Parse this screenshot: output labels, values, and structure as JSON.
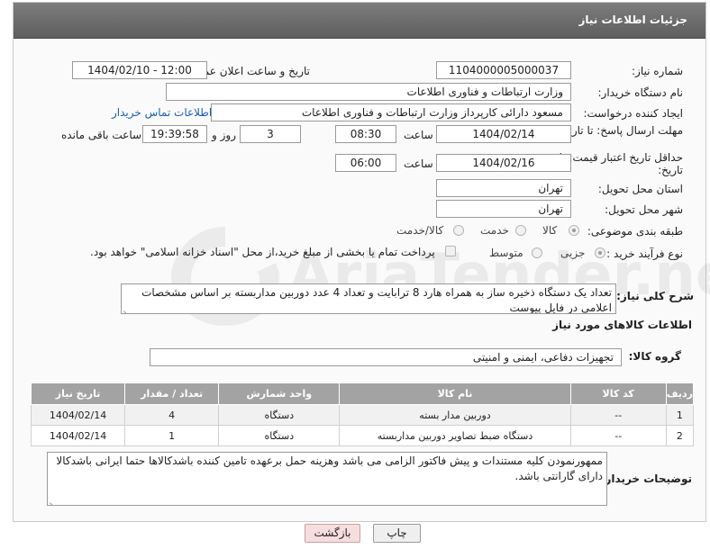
{
  "header": {
    "title": "جزئیات اطلاعات نیاز"
  },
  "form": {
    "need_number_label": "شماره نیاز:",
    "need_number": "1104000005000037",
    "announce_label": "تاریخ و ساعت اعلان عمومی:",
    "announce_value": "1404/02/10 - 12:00",
    "buyer_org_label": "نام دستگاه خریدار:",
    "buyer_org": "وزارت ارتباطات و فناوری اطلاعات",
    "creator_label": "ایجاد کننده درخواست:",
    "creator": "مسعود دارائی کارپرداز وزارت ارتباطات و فناوری اطلاعات",
    "contact_link": "اطلاعات تماس خریدار",
    "deadline_label": "مهلت ارسال پاسخ: تا تاریخ:",
    "deadline_date": "1404/02/14",
    "time_label": "ساعت",
    "deadline_time": "08:30",
    "days_value": "3",
    "days_and_label": "روز و",
    "remaining_time": "19:39:58",
    "remaining_label": "ساعت باقی مانده",
    "validity_label": "حداقل تاریخ اعتبار قیمت: تا تاریخ:",
    "validity_date": "1404/02/16",
    "validity_time": "06:00",
    "province_label": "استان محل تحویل:",
    "province": "تهران",
    "city_label": "شهر محل تحویل:",
    "city": "تهران",
    "category_label": "طبقه بندی موضوعی:",
    "category_options": [
      "کالا",
      "خدمت",
      "کالا/خدمت"
    ],
    "process_label": "نوع فرآیند خرید :",
    "process_options": [
      "جزیی",
      "متوسط"
    ],
    "payment_note": "پرداخت تمام یا بخشی از مبلغ خرید،از محل \"اسناد خزانه اسلامی\" خواهد بود."
  },
  "description": {
    "label": "شرح کلی نیاز:",
    "text": "تعداد یک دستگاه ذخیره ساز به همراه هارد 8 ترابایت و تعداد 4 عدد دوربین مداربسته بر اساس مشخصات اعلامی در فایل پیوست"
  },
  "goods": {
    "section_title": "اطلاعات کالاهای مورد نیاز",
    "group_label": "گروه کالا:",
    "group_value": "تجهیزات دفاعی، ایمنی و امنیتی",
    "columns": [
      "ردیف",
      "کد کالا",
      "نام کالا",
      "واحد شمارش",
      "تعداد / مقدار",
      "تاریخ نیاز"
    ],
    "rows": [
      [
        "1",
        "--",
        "دوربین مدار بسته",
        "دستگاه",
        "4",
        "1404/02/14"
      ],
      [
        "2",
        "--",
        "دستگاه ضبط تصاویر دوربین مداربسته",
        "دستگاه",
        "1",
        "1404/02/14"
      ]
    ]
  },
  "buyer_notes": {
    "label": "توضیحات خریدار:",
    "text": "ممهورنمودن کلیه مستندات و پیش فاکتور الزامی می باشد وهزینه حمل برعهده تامین کننده باشدکالاها حتما ایرانی باشدکالا دارای گارانتی باشد."
  },
  "buttons": {
    "print": "چاپ",
    "back": "بازگشت"
  },
  "watermark": "AriaTender.neT"
}
